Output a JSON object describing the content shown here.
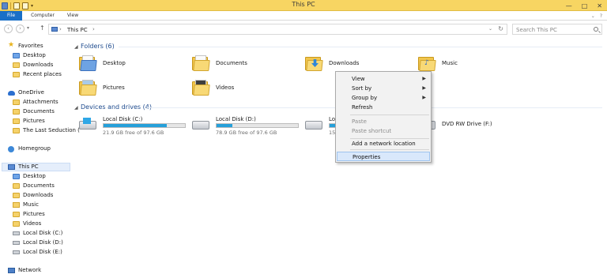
{
  "window": {
    "title": "This PC",
    "controls": [
      "—",
      "□",
      "✕"
    ]
  },
  "ribbon": {
    "tabs": [
      "File",
      "Computer",
      "View"
    ],
    "right": [
      "⌄",
      "?"
    ]
  },
  "address": {
    "crumb": "This PC",
    "search_placeholder": "Search This PC"
  },
  "nav": {
    "favorites": "Favorites",
    "fav_items": [
      "Desktop",
      "Downloads",
      "Recent places"
    ],
    "onedrive": "OneDrive",
    "od_items": [
      "Attachments",
      "Documents",
      "Pictures",
      "The Last Seduction ("
    ],
    "homegroup": "Homegroup",
    "thispc": "This PC",
    "pc_items": [
      "Desktop",
      "Documents",
      "Downloads",
      "Music",
      "Pictures",
      "Videos",
      "Local Disk (C:)",
      "Local Disk (D:)",
      "Local Disk (E:)"
    ],
    "network": "Network"
  },
  "content": {
    "folders_header": "Folders (6)",
    "folders": [
      "Desktop",
      "Documents",
      "Downloads",
      "Music",
      "Pictures",
      "Videos"
    ],
    "drives_header": "Devices and drives (4)",
    "drives": [
      {
        "name": "Local Disk (C:)",
        "free": "21.9 GB free of 97.6 GB",
        "used_fraction": 0.78
      },
      {
        "name": "Local Disk (D:)",
        "free": "78.9 GB free of 97.6 GB",
        "used_fraction": 0.19
      },
      {
        "name": "Loc",
        "free": "150",
        "used_fraction": 0.4
      }
    ],
    "dvd": "DVD RW Drive (F:)"
  },
  "context_menu": {
    "items": [
      "View",
      "Sort by",
      "Group by",
      "Refresh",
      "Paste",
      "Paste shortcut",
      "Add a network location",
      "Properties"
    ]
  },
  "colors": {
    "titlebar": "#f7d562",
    "file_tab": "#1a6fc7",
    "drive_fill": "#26a0da",
    "section_header": "#1e4b8e"
  }
}
